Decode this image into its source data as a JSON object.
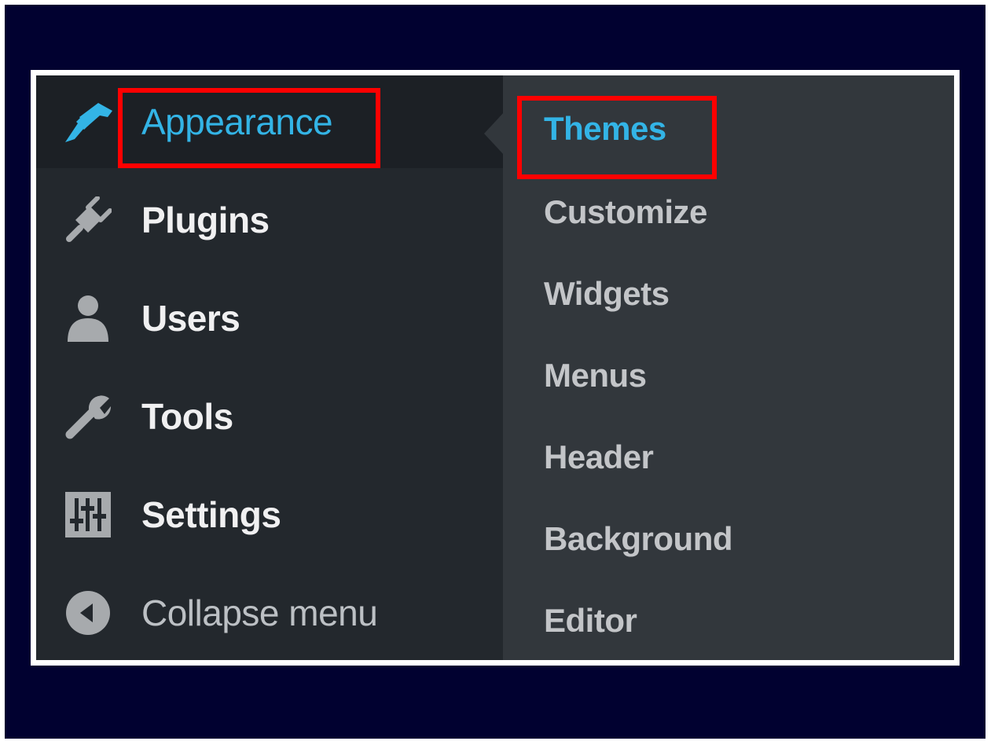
{
  "menu": {
    "items": [
      {
        "label": "Appearance",
        "icon": "paint-brush-icon",
        "current": true
      },
      {
        "label": "Plugins",
        "icon": "plug-icon"
      },
      {
        "label": "Users",
        "icon": "users-icon"
      },
      {
        "label": "Tools",
        "icon": "wrench-icon"
      },
      {
        "label": "Settings",
        "icon": "settings-sliders-icon"
      }
    ],
    "collapse_label": "Collapse menu",
    "collapse_icon": "collapse-arrow-icon"
  },
  "submenu": {
    "items": [
      {
        "label": "Themes",
        "current": true
      },
      {
        "label": "Customize"
      },
      {
        "label": "Widgets"
      },
      {
        "label": "Menus"
      },
      {
        "label": "Header"
      },
      {
        "label": "Background"
      },
      {
        "label": "Editor"
      }
    ]
  },
  "colors": {
    "sidebar_bg": "#23282d",
    "submenu_bg": "#32373c",
    "accent": "#33b4e6",
    "highlight": "#ff0000",
    "backdrop": "#010130"
  }
}
